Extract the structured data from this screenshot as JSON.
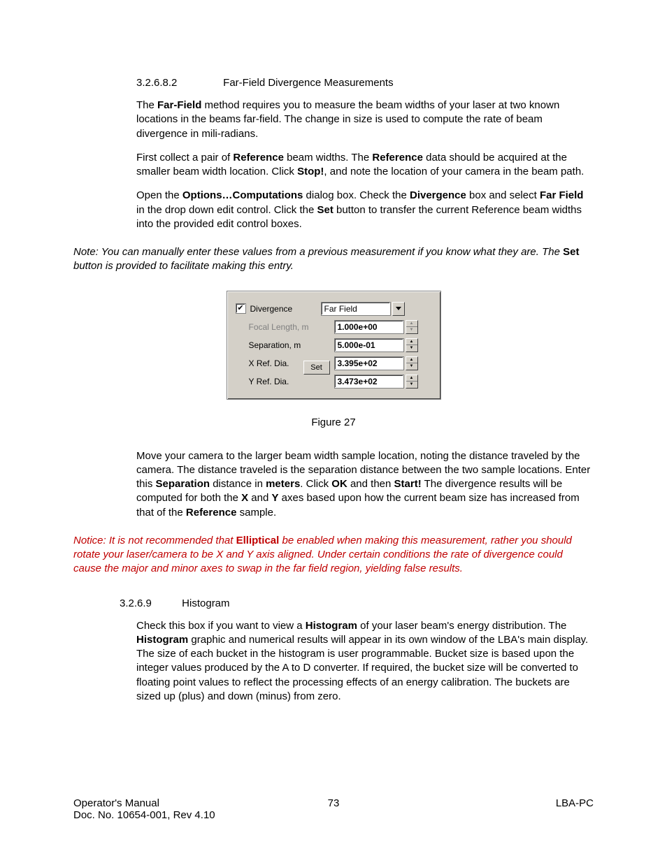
{
  "heading32682": {
    "num": "3.2.6.8.2",
    "title": "Far-Field Divergence Measurements"
  },
  "p1": {
    "a": "The ",
    "b": "Far-Field",
    "c": " method requires you to measure the beam widths of your laser at two known locations in the beams far-field.  The change in size is used to compute the rate of beam divergence in mili-radians."
  },
  "p2": {
    "a": "First collect a pair of ",
    "b": "Reference",
    "c": " beam widths.  The ",
    "d": "Reference",
    "e": " data should be acquired at the smaller beam width location.  Click ",
    "f": "Stop!",
    "g": ", and note the location of your camera in the beam path."
  },
  "p3": {
    "a": "Open the ",
    "b": "Options…Computations",
    "c": " dialog box.  Check the ",
    "d": "Divergence",
    "e": " box and select ",
    "f": "Far Field",
    "g": " in the drop down edit control.  Click the ",
    "h": "Set",
    "i": " button to transfer the current Reference beam widths into the provided edit control boxes."
  },
  "note": {
    "a": "Note:  You can manually enter these values from a previous measurement if you know what they are.  The ",
    "b": "Set",
    "c": " button is provided to facilitate making this entry."
  },
  "dialog": {
    "divergence_label": "Divergence",
    "divergence_checked": "✔",
    "method": "Far Field",
    "focal_label": "Focal Length, m",
    "focal_value": "1.000e+00",
    "sep_label": "Separation, m",
    "sep_value": "5.000e-01",
    "xref_label": "X Ref. Dia.",
    "xref_value": "3.395e+02",
    "yref_label": "Y Ref. Dia.",
    "yref_value": "3.473e+02",
    "set_label": "Set"
  },
  "figure_caption": "Figure 27",
  "p4": {
    "a": "Move your camera to the larger beam width sample location, noting the distance traveled by the camera.  The distance traveled is the separation distance between the two sample locations.  Enter this ",
    "b": "Separation",
    "c": " distance in ",
    "d": "meters",
    "e": ".  Click ",
    "f": "OK",
    "g": " and then ",
    "h": "Start!",
    "i": "  The divergence results will be computed for both the ",
    "j": "X",
    "k": " and ",
    "l": "Y",
    "m": " axes based upon how the current beam size has increased from that of the ",
    "n": "Reference",
    "o": " sample."
  },
  "notice": {
    "a": "Notice:  It is not recommended that ",
    "b": "Elliptical",
    "c": " be enabled when making this measurement, rather you should rotate your laser/camera to be X and Y axis aligned.  Under certain conditions the rate of divergence could cause the major and minor axes to swap in the far field region, yielding false results."
  },
  "heading3269": {
    "num": "3.2.6.9",
    "title": "Histogram"
  },
  "p5": {
    "a": "Check this box if you want to view a ",
    "b": "Histogram",
    "c": " of your laser beam's energy distribution.  The ",
    "d": "Histogram",
    "e": " graphic and numerical results will appear in its own window of the LBA's main display.  The size of each bucket in the histogram is user programmable.  Bucket size is based upon the integer values produced by the A to D converter.  If required, the bucket size will be converted to floating point values to reflect the processing effects of an energy calibration.  The buckets are sized up (plus) and down (minus) from zero."
  },
  "footer": {
    "left1": "Operator's Manual",
    "left2": "Doc. No. 10654-001, Rev 4.10",
    "center": "73",
    "right": "LBA-PC"
  }
}
